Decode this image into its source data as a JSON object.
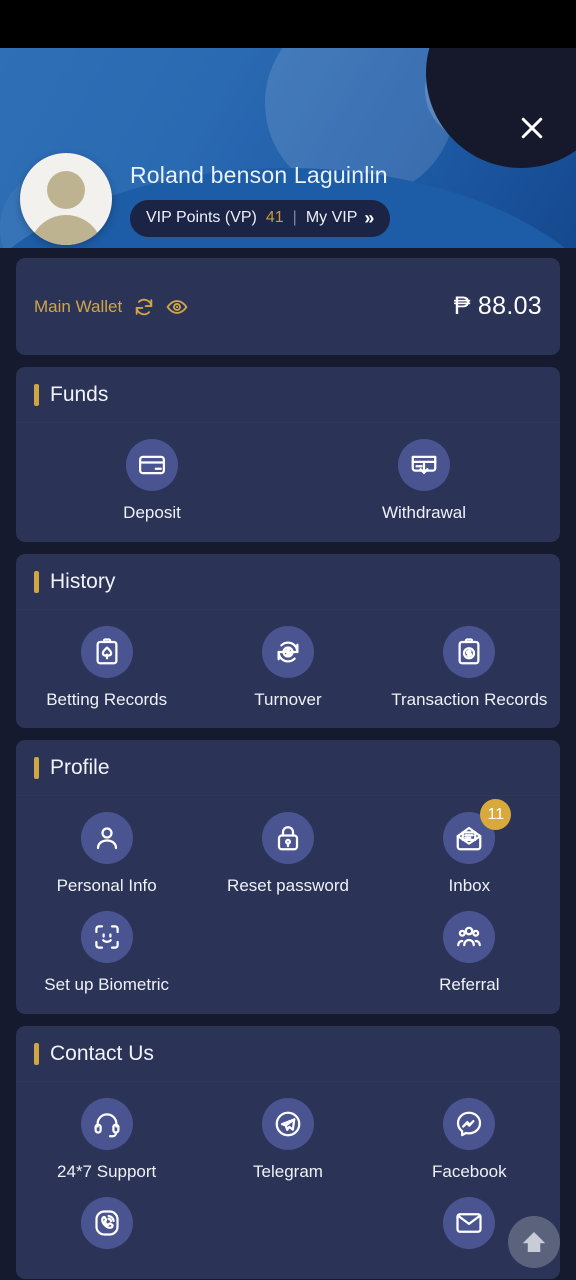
{
  "header": {
    "close_label": "close-icon",
    "username": "Roland benson Laguinlin",
    "vip": {
      "points_label": "VIP Points (VP)",
      "points_value": "41",
      "separator": "|",
      "my_vip_label": "My VIP",
      "chevron": "»"
    }
  },
  "wallet": {
    "label": "Main Wallet",
    "balance": "₱ 88.03"
  },
  "sections": [
    {
      "title": "Funds",
      "columns": 2,
      "items": [
        {
          "label": "Deposit",
          "icon": "card-icon"
        },
        {
          "label": "Withdrawal",
          "icon": "card-download-icon"
        }
      ]
    },
    {
      "title": "History",
      "columns": 3,
      "items": [
        {
          "label": "Betting Records",
          "icon": "clipboard-spade-icon"
        },
        {
          "label": "Turnover",
          "icon": "refresh-dollar-icon"
        },
        {
          "label": "Transaction Records",
          "icon": "clipboard-dollar-icon"
        }
      ]
    },
    {
      "title": "Profile",
      "columns": 3,
      "items": [
        {
          "label": "Personal Info",
          "icon": "user-icon"
        },
        {
          "label": "Reset password",
          "icon": "lock-icon"
        },
        {
          "label": "Inbox",
          "icon": "mail-open-icon",
          "badge": "11"
        },
        {
          "label": "Set up Biometric",
          "icon": "face-id-icon"
        },
        {
          "label": "",
          "icon": ""
        },
        {
          "label": "Referral",
          "icon": "group-icon"
        }
      ]
    },
    {
      "title": "Contact Us",
      "columns": 3,
      "items": [
        {
          "label": "24*7 Support",
          "icon": "headset-icon"
        },
        {
          "label": "Telegram",
          "icon": "telegram-icon"
        },
        {
          "label": "Facebook",
          "icon": "messenger-icon"
        },
        {
          "label": "",
          "icon": "viber-icon"
        },
        {
          "label": "",
          "icon": ""
        },
        {
          "label": "",
          "icon": "envelope-icon"
        }
      ]
    }
  ],
  "fab": {
    "name": "scroll-to-top"
  },
  "colors": {
    "gold": "#d0a544",
    "card_bg": "#2b3356",
    "page_bg": "#151a2e",
    "icon_circle": "#4a5490",
    "badge": "#d9a93c"
  }
}
